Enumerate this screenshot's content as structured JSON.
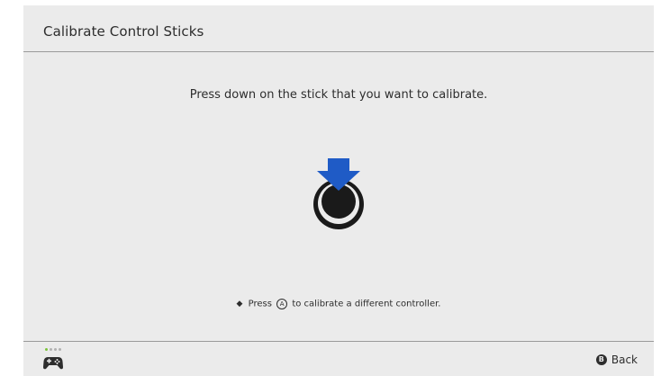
{
  "header": {
    "title": "Calibrate Control Sticks"
  },
  "main": {
    "instruction": "Press down on the stick that you want to calibrate.",
    "stick_icon": "stick-press-down-icon",
    "hint": {
      "bullet": "◆",
      "prefix": "Press",
      "button_glyph": "A",
      "suffix": "to calibrate a different controller."
    }
  },
  "footer": {
    "controller_icon": "controller-icon",
    "player_lights": [
      true,
      false,
      false,
      false
    ],
    "back_button_glyph": "B",
    "back_label": "Back"
  },
  "colors": {
    "background": "#ebebeb",
    "text": "#2d2d2d",
    "rule": "#9a9a9a",
    "arrow_blue": "#1f5bc6",
    "player_light_on": "#7bc43a",
    "player_light_off": "#b0b0b0"
  }
}
